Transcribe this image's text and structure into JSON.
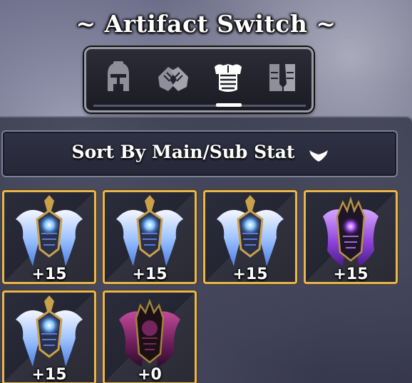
{
  "header": {
    "title": "~ Artifact Switch ~"
  },
  "tabs": [
    {
      "icon": "helmet-icon",
      "selected": false
    },
    {
      "icon": "gauntlets-icon",
      "selected": false
    },
    {
      "icon": "chest-armor-icon",
      "selected": true
    },
    {
      "icon": "boots-icon",
      "selected": false
    }
  ],
  "sort": {
    "label": "Sort By Main/Sub Stat",
    "icon": "chevron-down-icon"
  },
  "artifacts": [
    {
      "level": "+15",
      "style": "blue-winged-armor",
      "border_color": "#e9b64f"
    },
    {
      "level": "+15",
      "style": "blue-winged-armor",
      "border_color": "#e9b64f"
    },
    {
      "level": "+15",
      "style": "blue-winged-armor",
      "border_color": "#e9b64f"
    },
    {
      "level": "+15",
      "style": "purple-dark-armor",
      "border_color": "#e9b64f"
    },
    {
      "level": "+15",
      "style": "blue-winged-armor",
      "border_color": "#e9b64f"
    },
    {
      "level": "+0",
      "style": "crimson-dark-armor",
      "border_color": "#e9b64f"
    }
  ],
  "colors": {
    "frame_gold": "#e9b64f",
    "tab_active": "#ffffff",
    "tab_inactive": "#8e8f9a"
  }
}
